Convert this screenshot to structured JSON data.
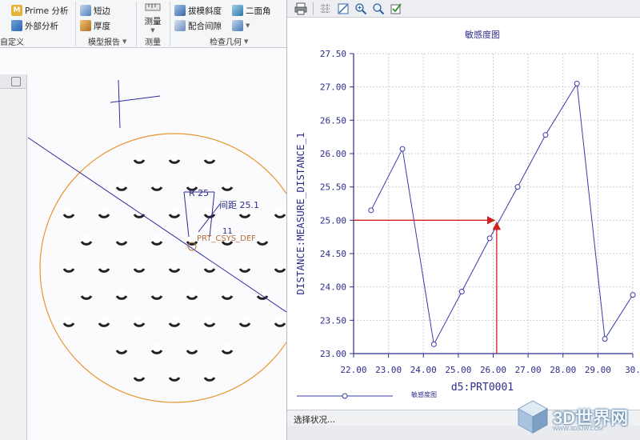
{
  "ribbon": {
    "prime_label": "Prime 分析",
    "external_label": "外部分析",
    "custom_group": "自定义",
    "short_edge": "短边",
    "thickness": "厚度",
    "model_report_group": "模型报告",
    "measure": "测量",
    "measure_group": "测量",
    "draft": "拔模斜度",
    "dihedral": "二面角",
    "clearance": "配合间隙",
    "inspect_group": "检查几何"
  },
  "model": {
    "radius_label": "R 25",
    "distance_label": "间距 25.1",
    "datum_label": "PRT_CSYS_DEF",
    "small_dim": "11",
    "colors": {
      "circle": "#e8952e",
      "line": "#2d2d9c",
      "background": "#fbfbfd"
    }
  },
  "graph_window": {
    "toolbar_icons": [
      "print-icon",
      "grid-icon",
      "fit-icon",
      "zoom-in-icon",
      "zoom-icon",
      "check-icon"
    ],
    "status_text": "选择状况..."
  },
  "chart_data": {
    "type": "line",
    "title": "敏感度图",
    "xlabel": "d5:PRT0001",
    "ylabel": "DISTANCE:MEASURE_DISTANCE_1",
    "xlim": [
      22.0,
      30.0
    ],
    "ylim": [
      23.0,
      27.5
    ],
    "xticks": [
      "22.00",
      "23.00",
      "24.00",
      "25.00",
      "26.00",
      "27.00",
      "28.00",
      "29.00",
      "30."
    ],
    "yticks": [
      "23.00",
      "23.50",
      "24.00",
      "24.50",
      "25.00",
      "25.50",
      "26.00",
      "26.50",
      "27.00",
      "27.50"
    ],
    "grid": true,
    "legend": "bottom",
    "series": [
      {
        "name": "敏感度图",
        "color": "#3a3aa6",
        "x": [
          22.5,
          23.4,
          24.3,
          25.1,
          25.9,
          26.7,
          27.5,
          28.4,
          29.2,
          30.0
        ],
        "y": [
          25.15,
          26.07,
          23.14,
          23.93,
          24.73,
          25.5,
          26.28,
          27.05,
          23.22,
          23.88
        ]
      }
    ],
    "annotation": {
      "x": 26.1,
      "y": 25.0,
      "color": "#d02020"
    }
  },
  "watermark": {
    "text": "3D世界网",
    "url": "WWW.3DSJW.COM"
  }
}
